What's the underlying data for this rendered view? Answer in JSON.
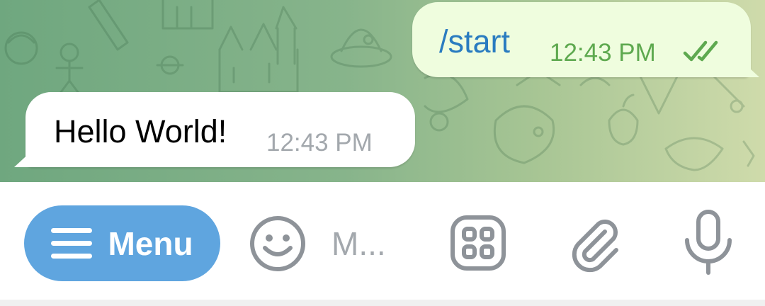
{
  "chat": {
    "messages": [
      {
        "direction": "outgoing",
        "text": "/start",
        "time": "12:43 PM",
        "status_icon": "double-check-icon"
      },
      {
        "direction": "incoming",
        "text": "Hello World!",
        "time": "12:43 PM"
      }
    ],
    "wallpaper": "green-doodle-pattern"
  },
  "input_bar": {
    "menu_button": {
      "label": "Menu",
      "icon": "hamburger-icon"
    },
    "emoji_icon": "smiley-icon",
    "message_placeholder": "M...",
    "commands_icon": "bot-commands-icon",
    "attach_icon": "paperclip-icon",
    "mic_icon": "microphone-icon"
  },
  "colors": {
    "outgoing_bubble": "#effdde",
    "outgoing_text": "#2a7cc0",
    "outgoing_time": "#5ea94f",
    "incoming_bubble": "#ffffff",
    "incoming_time": "#a3a8ad",
    "menu_button": "#5fa5df",
    "icon_gray": "#8e9399"
  }
}
